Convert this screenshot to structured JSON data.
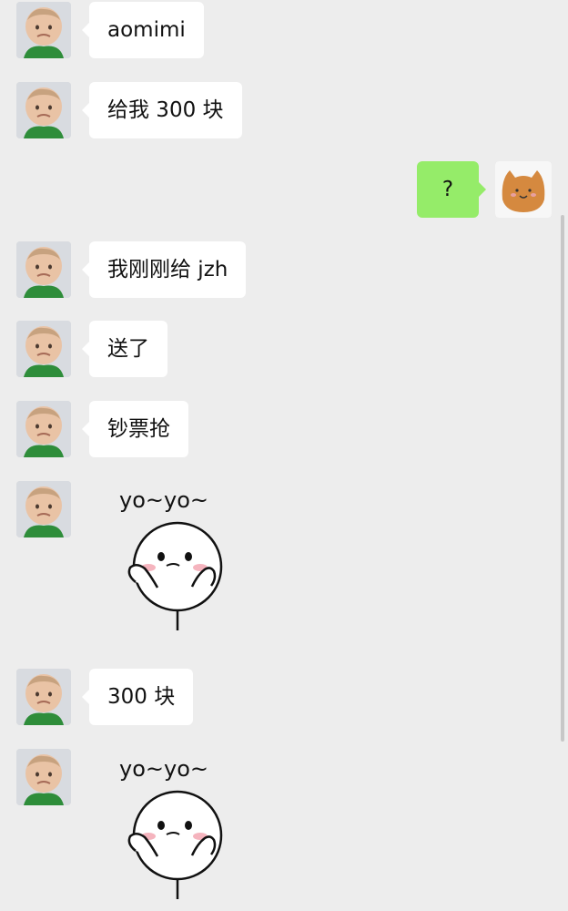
{
  "conversation": {
    "messages": [
      {
        "side": "incoming",
        "kind": "text",
        "text": "aomimi"
      },
      {
        "side": "incoming",
        "kind": "text",
        "text": "给我 300 块"
      },
      {
        "side": "outgoing",
        "kind": "text",
        "text": "?"
      },
      {
        "side": "incoming",
        "kind": "text",
        "text": "我刚刚给 jzh"
      },
      {
        "side": "incoming",
        "kind": "text",
        "text": "送了"
      },
      {
        "side": "incoming",
        "kind": "text",
        "text": "钞票抢"
      },
      {
        "side": "incoming",
        "kind": "sticker",
        "text": "yo~yo~",
        "sticker_icon": "yoyo-sticker-icon"
      },
      {
        "side": "incoming",
        "kind": "text",
        "text": "300 块"
      },
      {
        "side": "incoming",
        "kind": "sticker",
        "text": "yo~yo~",
        "sticker_icon": "yoyo-sticker-icon"
      }
    ]
  },
  "colors": {
    "chat_background": "#ededed",
    "incoming_bubble": "#ffffff",
    "outgoing_bubble": "#95ec69",
    "scrollbar": "#c7c7c7"
  },
  "icons": {
    "contact_avatar": "baby-avatar-icon",
    "self_avatar": "cat-bun-avatar-icon",
    "sticker": "yoyo-sticker-icon"
  }
}
